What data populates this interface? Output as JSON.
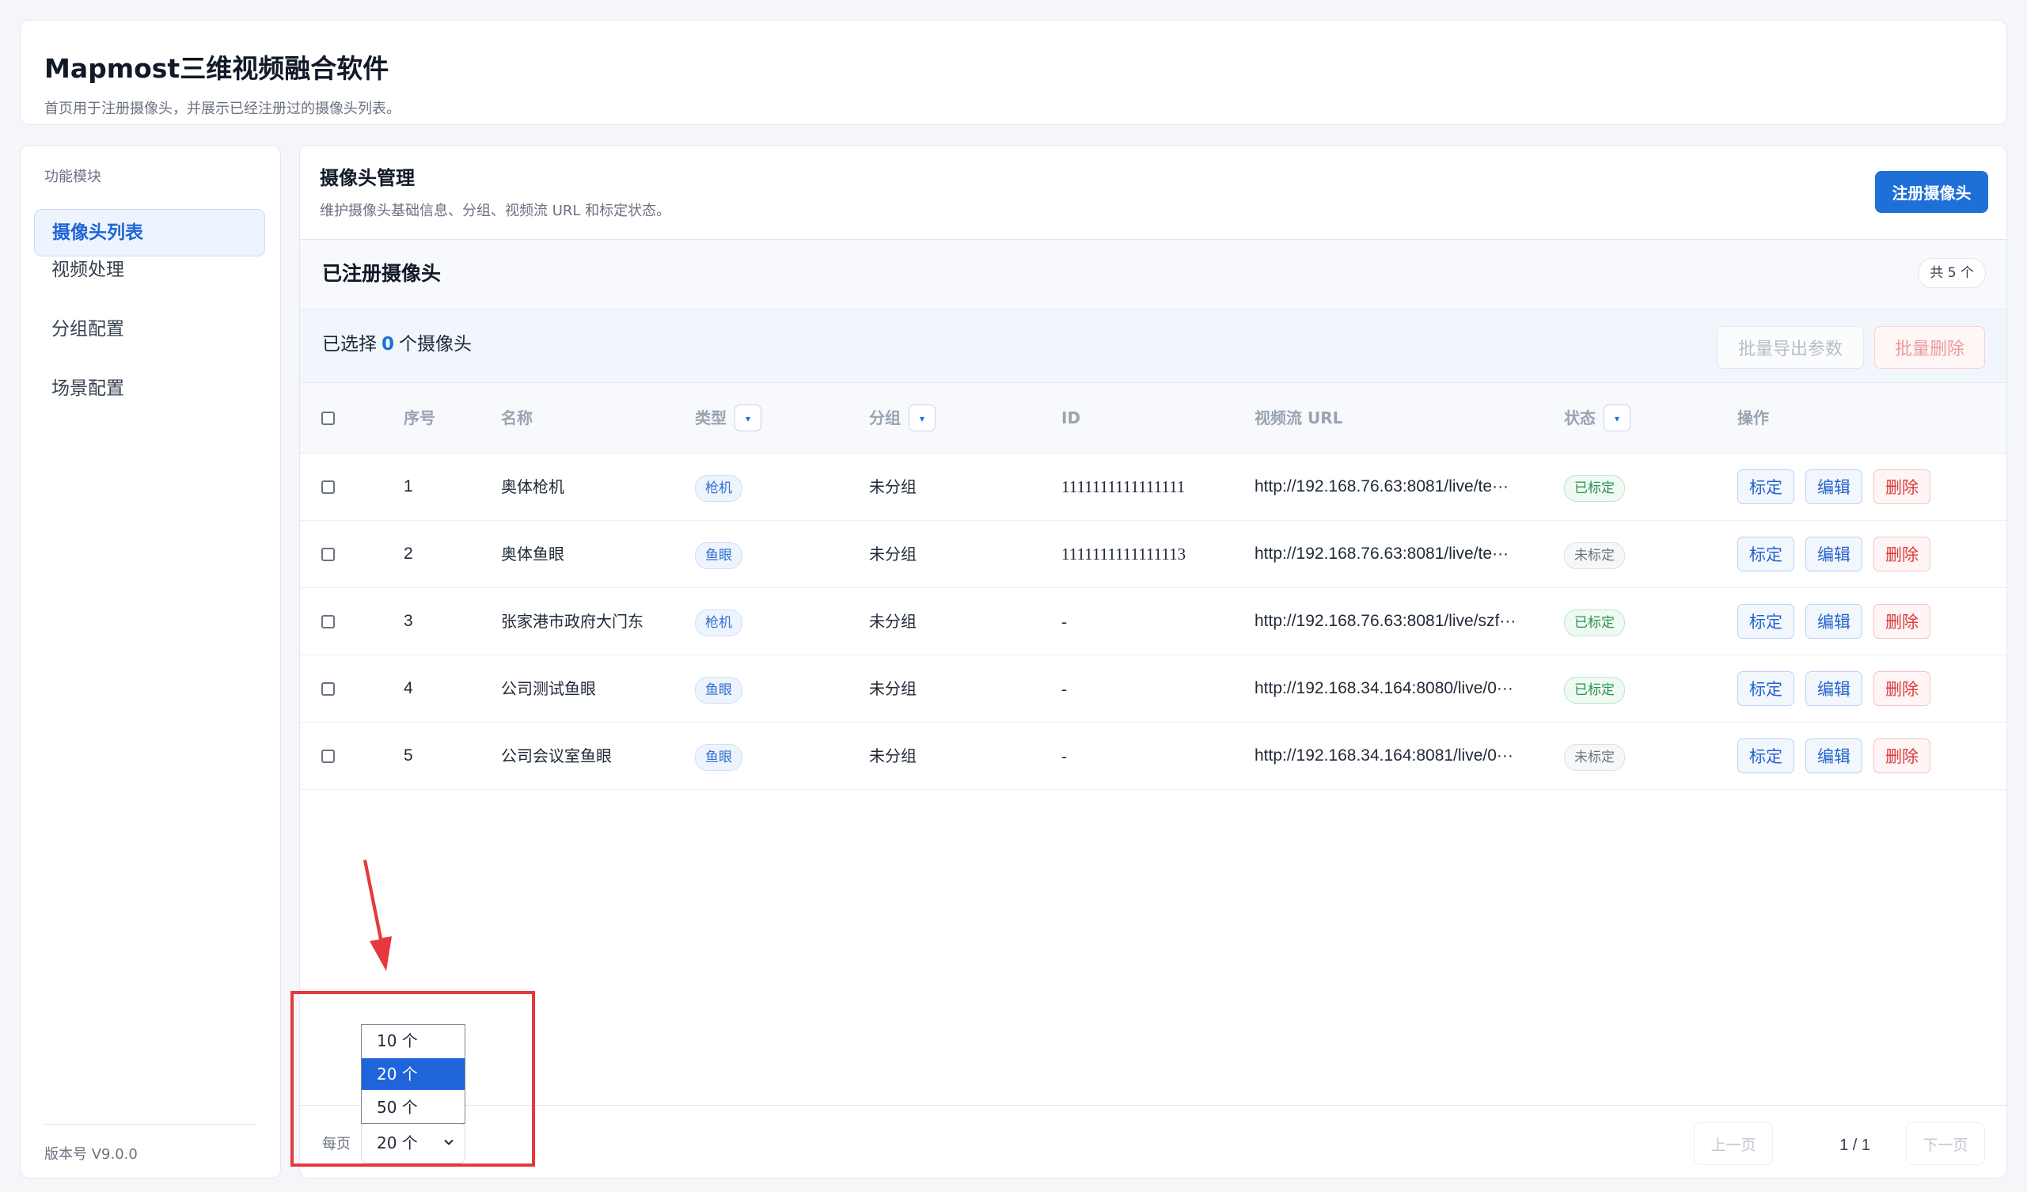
{
  "app": {
    "title": "Mapmost三维视频融合软件",
    "subtitle": "首页用于注册摄像头，并展示已经注册过的摄像头列表。"
  },
  "sidebar": {
    "heading": "功能模块",
    "items": [
      {
        "label": "摄像头列表",
        "active": true
      },
      {
        "label": "视频处理",
        "active": false
      },
      {
        "label": "分组配置",
        "active": false
      },
      {
        "label": "场景配置",
        "active": false
      }
    ],
    "version": "版本号 V9.0.0"
  },
  "management": {
    "title": "摄像头管理",
    "subtitle": "维护摄像头基础信息、分组、视频流 URL 和标定状态。",
    "register_label": "注册摄像头"
  },
  "registered": {
    "title": "已注册摄像头",
    "total_badge": "共 5 个"
  },
  "selection": {
    "prefix": "已选择",
    "count": "0",
    "suffix": "个摄像头",
    "bulk_export_label": "批量导出参数",
    "bulk_delete_label": "批量删除"
  },
  "table": {
    "headers": {
      "index": "序号",
      "name": "名称",
      "type": "类型",
      "group": "分组",
      "id": "ID",
      "url": "视频流 URL",
      "status": "状态",
      "actions": "操作"
    },
    "filter_glyph": "▾",
    "action_labels": {
      "calibrate": "标定",
      "edit": "编辑",
      "delete": "删除"
    },
    "rows": [
      {
        "index": "1",
        "name": "奥体枪机",
        "type": "枪机",
        "group": "未分组",
        "id": "1111111111111111",
        "url": "http://192.168.76.63:8081/live/te···",
        "status": "已标定",
        "calibrated": true
      },
      {
        "index": "2",
        "name": "奥体鱼眼",
        "type": "鱼眼",
        "group": "未分组",
        "id": "1111111111111113",
        "url": "http://192.168.76.63:8081/live/te···",
        "status": "未标定",
        "calibrated": false
      },
      {
        "index": "3",
        "name": "张家港市政府大门东",
        "type": "枪机",
        "group": "未分组",
        "id": "-",
        "url": "http://192.168.76.63:8081/live/szf···",
        "status": "已标定",
        "calibrated": true
      },
      {
        "index": "4",
        "name": "公司测试鱼眼",
        "type": "鱼眼",
        "group": "未分组",
        "id": "-",
        "url": "http://192.168.34.164:8080/live/0···",
        "status": "已标定",
        "calibrated": true
      },
      {
        "index": "5",
        "name": "公司会议室鱼眼",
        "type": "鱼眼",
        "group": "未分组",
        "id": "-",
        "url": "http://192.168.34.164:8081/live/0···",
        "status": "未标定",
        "calibrated": false
      }
    ]
  },
  "pagination": {
    "per_page_label": "每页",
    "per_page_value": "20 个",
    "options": [
      "10 个",
      "20 个",
      "50 个"
    ],
    "selected_option": "20 个",
    "prev_label": "上一页",
    "next_label": "下一页",
    "page_indicator": "1 / 1"
  },
  "colors": {
    "primary": "#1f6fd8",
    "danger": "#dc3a3a",
    "annotation": "#e5393d",
    "success": "#2e8f4e"
  },
  "icons": {
    "filter": "caret-down-icon",
    "select_chevron": "chevron-down-icon",
    "annotation": "red-arrow-annotation"
  }
}
